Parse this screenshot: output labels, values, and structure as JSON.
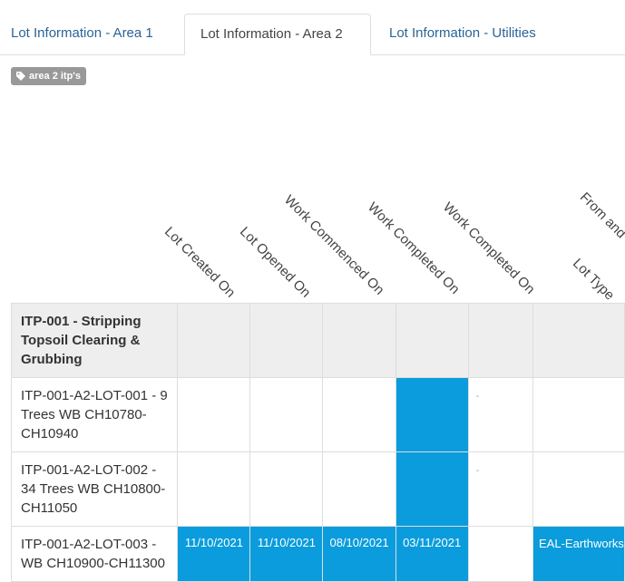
{
  "tabs": [
    {
      "label": "Lot Information - Area 1"
    },
    {
      "label": "Lot Information - Area 2"
    },
    {
      "label": "Lot Information - Utilities"
    }
  ],
  "tag": {
    "label": "area 2 itp's",
    "icon": "tag-icon"
  },
  "columns": [
    {
      "label": "Lot Created On"
    },
    {
      "label": "Lot Opened On"
    },
    {
      "label": "Work Commenced On"
    },
    {
      "label": "Work Completed On"
    },
    {
      "label": "Work Completed On"
    },
    {
      "label": "Lot Type"
    },
    {
      "label": "From and"
    }
  ],
  "group": {
    "name": "ITP-001 - Stripping Topsoil Clearing & Grubbing"
  },
  "rows": [
    {
      "name": "ITP-001-A2-LOT-001 - 9 Trees WB CH10780-CH10940",
      "dash": "-"
    },
    {
      "name": "ITP-001-A2-LOT-002 - 34 Trees WB CH10800-CH11050",
      "dash": "-"
    },
    {
      "name": "ITP-001-A2-LOT-003 - WB CH10900-CH11300",
      "lot_created": "11/10/2021",
      "lot_opened": "11/10/2021",
      "work_commenced": "08/10/2021",
      "work_completed": "03/11/2021",
      "lot_type": "EAL-Earthworks"
    }
  ],
  "colors": {
    "accent": "#0a9cdc",
    "link": "#2a6496",
    "group_bg": "#eeeeee",
    "tag_bg": "#999999"
  }
}
